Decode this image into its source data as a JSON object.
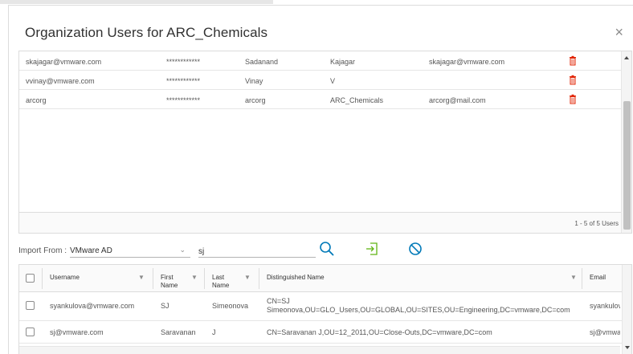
{
  "dialog": {
    "title_prefix": "Organization Users for ",
    "org_name": "ARC_Chemicals",
    "close_glyph": "×"
  },
  "org_users": {
    "rows": [
      {
        "username": "skajagar@vmware.com",
        "password": "************",
        "first_name": "Sadanand",
        "last_name": "Kajagar",
        "email": "skajagar@vmware.com"
      },
      {
        "username": "vvinay@vmware.com",
        "password": "************",
        "first_name": "Vinay",
        "last_name": "V",
        "email": ""
      },
      {
        "username": "arcorg",
        "password": "************",
        "first_name": "arcorg",
        "last_name": "ARC_Chemicals",
        "email": "arcorg@mail.com"
      }
    ],
    "footer_count": "1 - 5 of 5 Users"
  },
  "import": {
    "label": "Import From :",
    "source": "VMware AD",
    "search_value": "sj",
    "icons": [
      "search-icon",
      "import-icon",
      "cancel-icon"
    ]
  },
  "ad_results": {
    "headers": {
      "username": "Username",
      "first_name": "First Name",
      "last_name": "Last Name",
      "dn": "Distinguished Name",
      "email": "Email"
    },
    "rows": [
      {
        "username": "syankulova@vmware.com",
        "first_name": "SJ",
        "last_name": "Simeonova",
        "dn_line1": "CN=SJ",
        "dn_line2": "Simeonova,OU=GLO_Users,OU=GLOBAL,OU=SITES,OU=Engineering,DC=vmware,DC=com",
        "email": "syankulova"
      },
      {
        "username": "sj@vmware.com",
        "first_name": "Saravanan",
        "last_name": "J",
        "dn_line1": "CN=Saravanan J,OU=12_2011,OU=Close-Outs,DC=vmware,DC=com",
        "dn_line2": "",
        "email": "sj@vmware"
      }
    ]
  },
  "colors": {
    "accent": "#0079b8",
    "success": "#60b515",
    "danger": "#e12200"
  }
}
